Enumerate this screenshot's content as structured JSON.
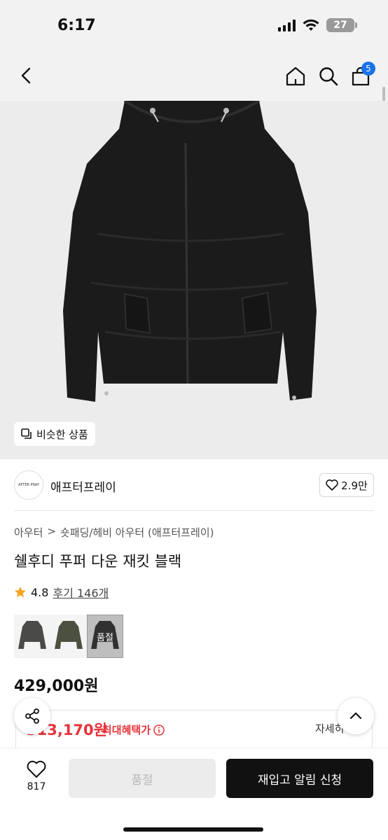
{
  "status_bar": {
    "time": "6:17",
    "battery": "27"
  },
  "nav": {
    "cart_count": "5"
  },
  "hero": {
    "similar_label": "비슷한 상품"
  },
  "brand": {
    "logo_text": "AFTER PRAY",
    "name": "애프터프레이",
    "likes": "2.9만"
  },
  "breadcrumb": {
    "category": "아우터",
    "separator": ">",
    "subcategory": "숏패딩/헤비 아우터 (애프터프레이)"
  },
  "product": {
    "title": "쉘후디 푸퍼 다운 재킷 블랙",
    "rating": "4.8",
    "review_label": "후기 146개",
    "colors": [
      {
        "name": "charcoal",
        "color": "#4a4a48",
        "sold_out": false
      },
      {
        "name": "khaki",
        "color": "#4b5040",
        "sold_out": false
      },
      {
        "name": "black",
        "color": "#1c1c1c",
        "sold_out": true,
        "label": "품절"
      }
    ],
    "price": "429,000원",
    "benefit_price": "313,170원",
    "benefit_label": "최대혜택가",
    "benefit_detail": "자세히"
  },
  "bottom": {
    "wish_count": "817",
    "soldout_label": "품절",
    "restock_label": "재입고 알림 신청"
  },
  "colors": {
    "accent_red": "#e8333a",
    "badge_blue": "#1a73e8",
    "primary_black": "#111111"
  }
}
